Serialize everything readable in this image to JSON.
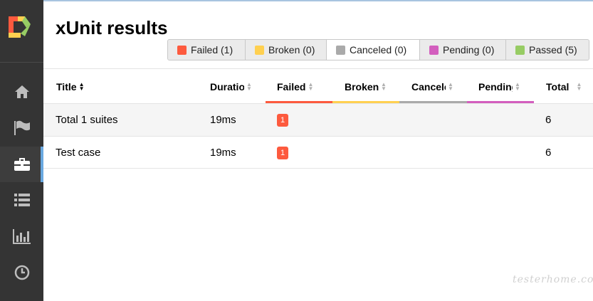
{
  "page": {
    "title": "xUnit results"
  },
  "colors": {
    "failed": "#fd5a3e",
    "broken": "#ffd050",
    "canceled": "#aaaaaa",
    "pending": "#d35ebe",
    "passed": "#97cc64",
    "sidebar": "#343434",
    "accent": "#6aa8e0"
  },
  "sidebar": {
    "logo": "allure-logo-icon",
    "items": [
      {
        "icon": "home-icon"
      },
      {
        "icon": "flag-icon"
      },
      {
        "icon": "briefcase-icon",
        "active": true
      },
      {
        "icon": "list-icon"
      },
      {
        "icon": "bar-chart-icon"
      },
      {
        "icon": "clock-icon"
      }
    ]
  },
  "filters": [
    {
      "label": "Failed (1)",
      "status": "failed"
    },
    {
      "label": "Broken (0)",
      "status": "broken"
    },
    {
      "label": "Canceled (0)",
      "status": "canceled"
    },
    {
      "label": "Pending (0)",
      "status": "pending"
    },
    {
      "label": "Passed (5)",
      "status": "passed"
    }
  ],
  "table": {
    "columns": [
      "Title",
      "Duration",
      "Failed",
      "Broken",
      "Canceled",
      "Pending",
      "Total"
    ],
    "rows": [
      {
        "title": "Total 1 suites",
        "duration": "19ms",
        "failed": "1",
        "total": "6"
      },
      {
        "title": "Test case",
        "duration": "19ms",
        "failed": "1",
        "total": "6"
      }
    ]
  },
  "watermark": "testerhome.com"
}
